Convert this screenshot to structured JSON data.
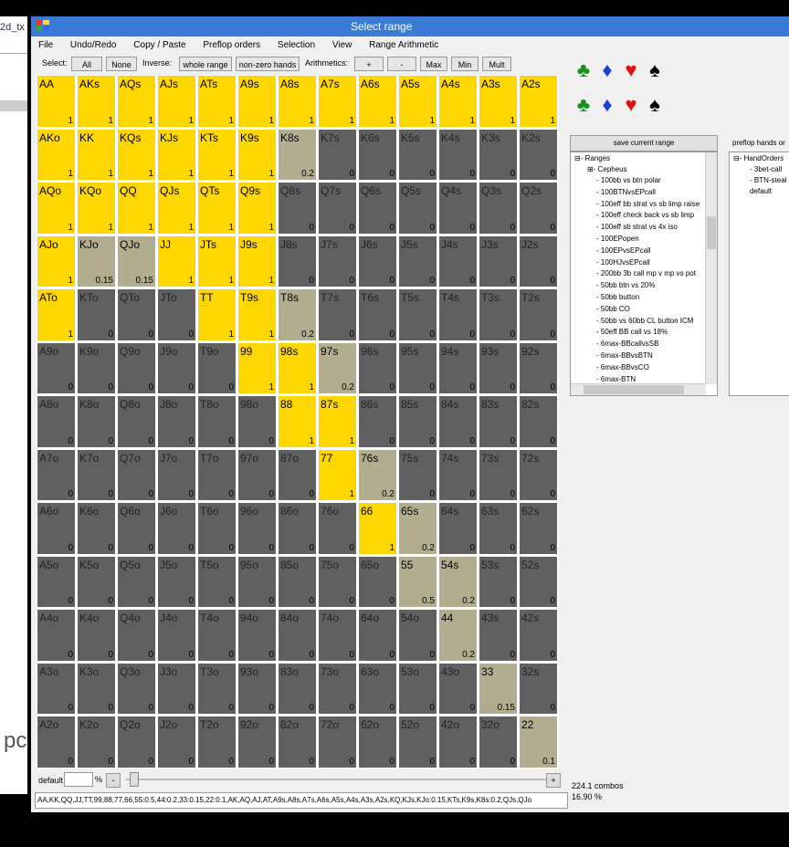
{
  "bg_window": {
    "title": "2d_tx",
    "text_fragment": "pc"
  },
  "window": {
    "title": "Select range"
  },
  "menu": [
    "File",
    "Undo/Redo",
    "Copy / Paste",
    "Preflop orders",
    "Selection",
    "View",
    "Range Arithmetic"
  ],
  "toolbar": {
    "select_label": "Select:",
    "all": "All",
    "none": "None",
    "inverse_label": "Inverse:",
    "whole_range": "whole range",
    "non_zero": "non-zero hands",
    "arith_label": "Arithmetics:",
    "plus": "+",
    "minus": "-",
    "max": "Max",
    "min": "Min",
    "mult": "Mult"
  },
  "colors": {
    "selected": "#ffd700",
    "partial": "#b3ad90",
    "unselected": "#606060"
  },
  "matrix": {
    "ranks": [
      "A",
      "K",
      "Q",
      "J",
      "T",
      "9",
      "8",
      "7",
      "6",
      "5",
      "4",
      "3",
      "2"
    ],
    "frequencies": [
      [
        1,
        1,
        1,
        1,
        1,
        1,
        1,
        1,
        1,
        1,
        1,
        1,
        1
      ],
      [
        1,
        1,
        1,
        1,
        1,
        1,
        0.2,
        0,
        0,
        0,
        0,
        0,
        0
      ],
      [
        1,
        1,
        1,
        1,
        1,
        1,
        0,
        0,
        0,
        0,
        0,
        0,
        0
      ],
      [
        1,
        0.15,
        0.15,
        1,
        1,
        1,
        0,
        0,
        0,
        0,
        0,
        0,
        0
      ],
      [
        1,
        0,
        0,
        0,
        1,
        1,
        0.2,
        0,
        0,
        0,
        0,
        0,
        0
      ],
      [
        0,
        0,
        0,
        0,
        0,
        1,
        1,
        0.2,
        0,
        0,
        0,
        0,
        0
      ],
      [
        0,
        0,
        0,
        0,
        0,
        0,
        1,
        1,
        0,
        0,
        0,
        0,
        0
      ],
      [
        0,
        0,
        0,
        0,
        0,
        0,
        0,
        1,
        0.2,
        0,
        0,
        0,
        0
      ],
      [
        0,
        0,
        0,
        0,
        0,
        0,
        0,
        0,
        1,
        0.2,
        0,
        0,
        0
      ],
      [
        0,
        0,
        0,
        0,
        0,
        0,
        0,
        0,
        0,
        0.5,
        0.2,
        0,
        0
      ],
      [
        0,
        0,
        0,
        0,
        0,
        0,
        0,
        0,
        0,
        0,
        0.2,
        0,
        0
      ],
      [
        0,
        0,
        0,
        0,
        0,
        0,
        0,
        0,
        0,
        0,
        0,
        0.15,
        0
      ],
      [
        0,
        0,
        0,
        0,
        0,
        0,
        0,
        0,
        0,
        0,
        0,
        0,
        0.1
      ]
    ]
  },
  "suits": {
    "row1": [
      {
        "glyph": "♣",
        "color": "#1a8f1a",
        "icon": "club-icon"
      },
      {
        "glyph": "♦",
        "color": "#1a3fd6",
        "icon": "diamond-icon"
      },
      {
        "glyph": "♥",
        "color": "#e01010",
        "icon": "heart-icon"
      },
      {
        "glyph": "♠",
        "color": "#000000",
        "icon": "spade-icon"
      }
    ],
    "row2": [
      {
        "glyph": "♣",
        "color": "#1a8f1a",
        "icon": "club-icon"
      },
      {
        "glyph": "♦",
        "color": "#1a3fd6",
        "icon": "diamond-icon"
      },
      {
        "glyph": "♥",
        "color": "#e01010",
        "icon": "heart-icon"
      },
      {
        "glyph": "♠",
        "color": "#000000",
        "icon": "spade-icon"
      }
    ]
  },
  "save_button": "save current range",
  "ranges_tree": {
    "root": "Ranges",
    "folder": "Cepheus",
    "items": [
      "100bb vs btn polar",
      "100BTNvsEPcall",
      "100eff bb strat vs sb limp raise",
      "100eff check back vs sb limp",
      "100eff sb strat vs 4x iso",
      "100EPopen",
      "100EPvsEPcall",
      "100HJvsEPcall",
      "200bb 3b call mp v mp vs pot",
      "50bb btn vs 20%",
      "50bb button",
      "50bb CO",
      "50bb vs 60bb CL button ICM",
      "50eff BB call vs 18%",
      "6max-BBcallvsSB",
      "6max-BBvsBTN",
      "6max-BBvsCO",
      "6max-BTN"
    ]
  },
  "preflop_orders": {
    "label": "preflop hands or",
    "root": "HandOrders",
    "items": [
      "3bet-call",
      "BTN-steal",
      "default"
    ]
  },
  "bottom": {
    "default_label": "default",
    "pct_sign": "%",
    "minus": "-",
    "plus": "+",
    "range_string": "AA,KK,QQ,JJ,TT,99,88,77,66,55:0.5,44:0.2,33:0.15,22:0.1,AK,AQ,AJ,AT,A9s,A8s,A7s,A6s,A5s,A4s,A3s,A2s,KQ,KJs,KJo:0.15,KTs,K9s,K8s:0.2,QJs,QJo",
    "combos": "224.1 combos",
    "percent": "16.90 %"
  }
}
